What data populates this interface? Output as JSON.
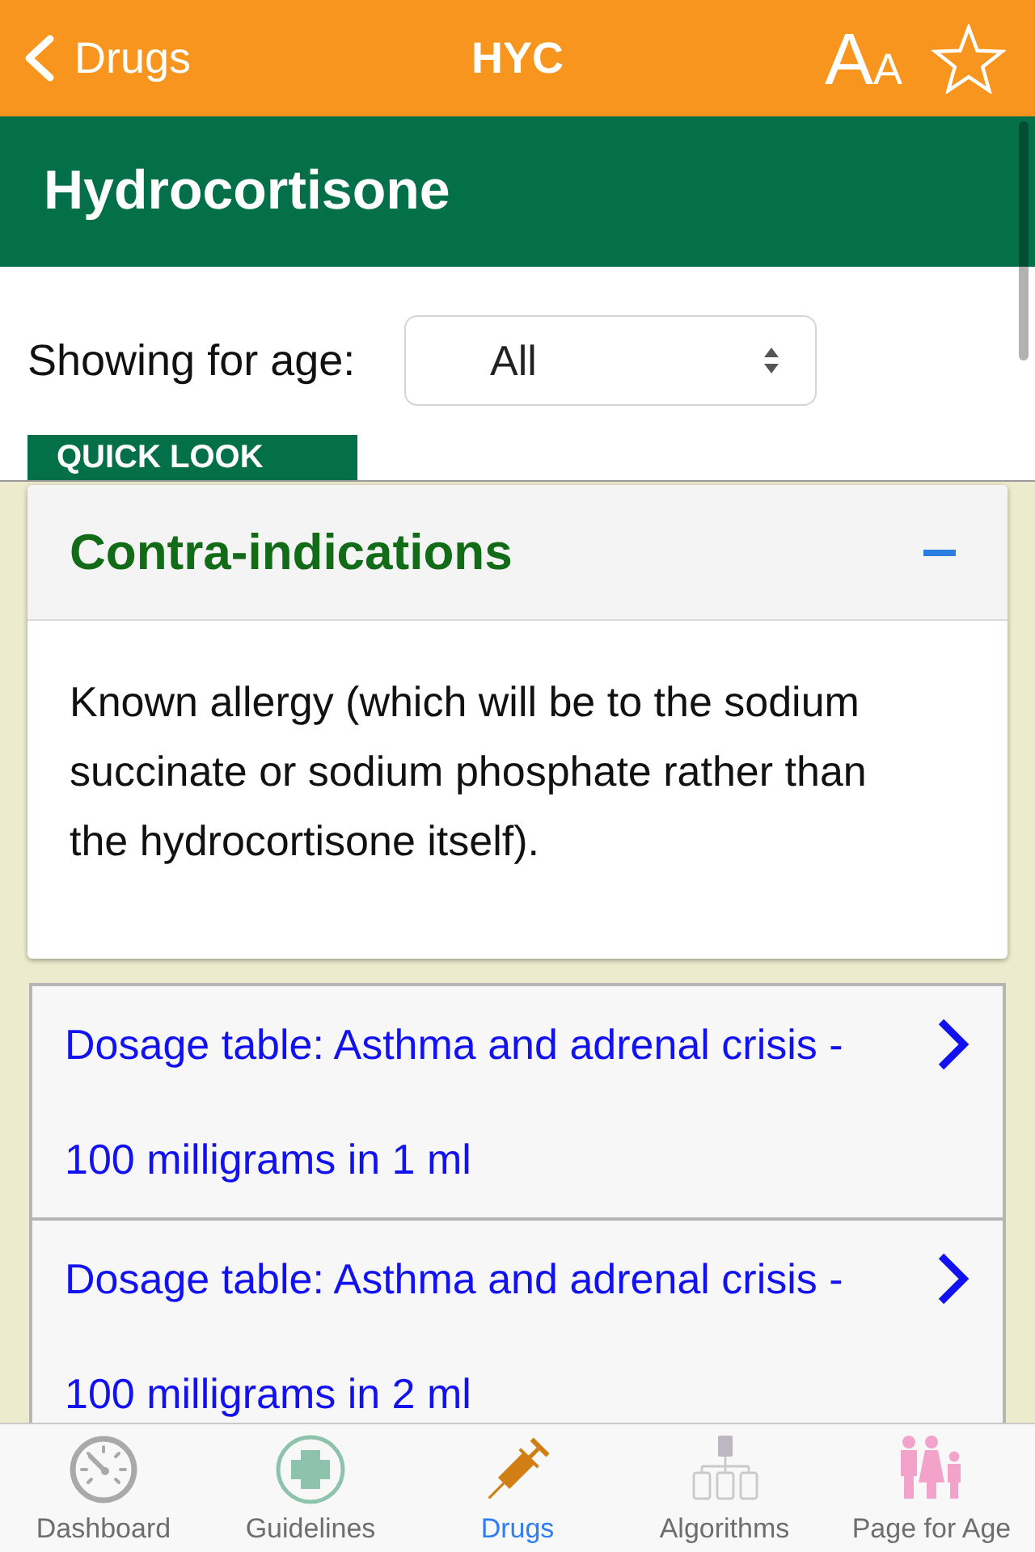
{
  "nav_bar": {
    "back_label": "Drugs",
    "title": "HYC",
    "text_size_button": {
      "large": "A",
      "small": "A"
    },
    "favorited": false
  },
  "drug_header": {
    "title": "Hydrocortisone"
  },
  "age_filter": {
    "label": "Showing for age:",
    "value": "All"
  },
  "section_tab": {
    "label": "QUICK LOOK"
  },
  "sections": [
    {
      "title": "Contra-indications",
      "expanded": true,
      "body": "Known allergy (which will be to the sodium succinate or sodium phosphate rather than the hydrocortisone itself)."
    }
  ],
  "links": [
    {
      "label": "Dosage table: Asthma and adrenal crisis - 100 milligrams in 1 ml"
    },
    {
      "label": "Dosage table: Asthma and adrenal crisis - 100 milligrams in 2 ml"
    }
  ],
  "tab_bar": [
    {
      "kind": "dashboard",
      "label": "Dashboard",
      "selected": false
    },
    {
      "kind": "guidelines",
      "label": "Guidelines",
      "selected": false
    },
    {
      "kind": "drugs",
      "label": "Drugs",
      "selected": true
    },
    {
      "kind": "algorithms",
      "label": "Algorithms",
      "selected": false
    },
    {
      "kind": "age",
      "label": "Page for Age",
      "selected": false
    }
  ]
}
